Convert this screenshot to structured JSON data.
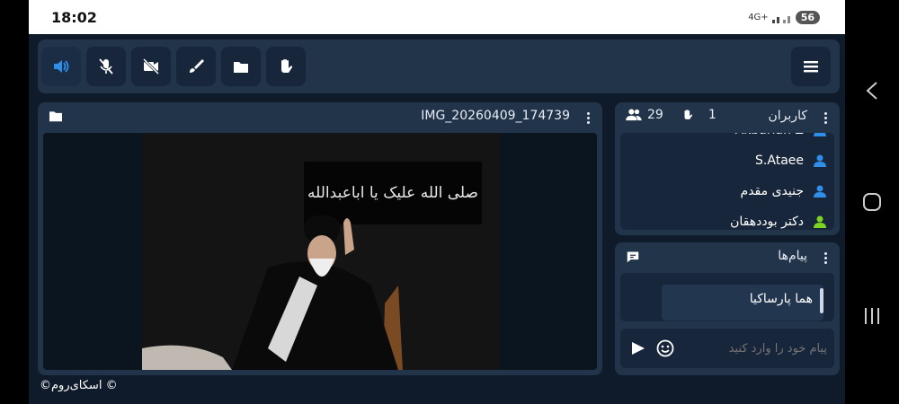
{
  "status_bar": {
    "time": "18:02",
    "network": "4G+",
    "battery": "56"
  },
  "toolbar": {
    "buttons": [
      {
        "name": "speaker-icon",
        "active": true
      },
      {
        "name": "mic-off-icon"
      },
      {
        "name": "camera-off-icon"
      },
      {
        "name": "brush-icon"
      },
      {
        "name": "folder-icon"
      },
      {
        "name": "raise-hand-icon"
      }
    ]
  },
  "video": {
    "file_name": "IMG_20260409_174739",
    "calligraphy": "صلی الله علیک یا اباعبدالله"
  },
  "users_panel": {
    "title": "کاربران",
    "hand_count": "1",
    "user_count": "29",
    "users": [
      {
        "name": "Akbarian Z",
        "status": "blue"
      },
      {
        "name": "S.Ataee",
        "status": "blue"
      },
      {
        "name": "جنیدی مقدم",
        "status": "blue"
      },
      {
        "name": "دکتر بوددهقان",
        "status": "green"
      }
    ]
  },
  "messages_panel": {
    "title": "پیام‌ها",
    "messages": [
      {
        "text": "هما پارساکیا"
      }
    ],
    "input_placeholder": "پیام خود را وارد کنید"
  },
  "footer": {
    "copyright": "©اسکای‌روم ©"
  },
  "colors": {
    "accent": "#2f8fe8",
    "panel": "#22344a",
    "background": "#0f1a2a",
    "online_green": "#7ed321"
  }
}
